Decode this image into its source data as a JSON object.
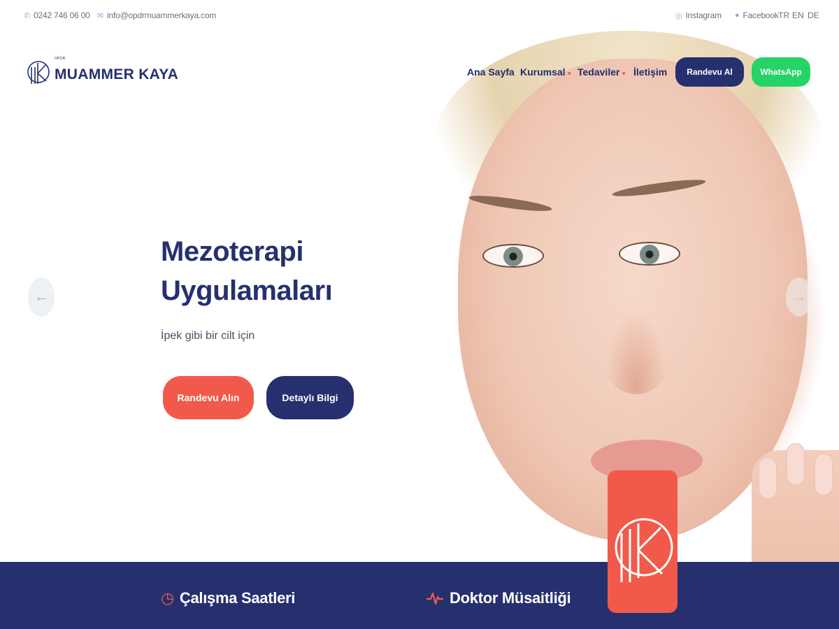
{
  "topbar": {
    "phone": "0242 746 06 00",
    "email": "info@opdrmuammerkaya.com",
    "instagram": "Instagram",
    "facebook": "Facebook",
    "languages": [
      "TR",
      "EN",
      "DE"
    ],
    "icons": {
      "phone": "phone-icon",
      "email": "mail-icon",
      "instagram": "instagram-icon",
      "facebook": "facebook-icon"
    }
  },
  "header": {
    "logo_small": "OP.DR.",
    "logo_text": "MUAMMER KAYA",
    "nav": [
      {
        "label": "Ana Sayfa",
        "has_dropdown": false
      },
      {
        "label": "Kurumsal",
        "has_dropdown": true
      },
      {
        "label": "Tedaviler",
        "has_dropdown": true
      },
      {
        "label": "İletişim",
        "has_dropdown": false
      }
    ],
    "appointment_button": "Randevu Al",
    "whatsapp_button": "WhatsApp"
  },
  "hero": {
    "title_line1": "Mezoterapi",
    "title_line2": "Uygulamaları",
    "subtitle": "İpek gibi bir cilt için",
    "primary_cta": "Randevu Alın",
    "secondary_cta": "Detaylı Bilgi",
    "prev_icon": "arrow-left-icon",
    "next_icon": "arrow-right-icon"
  },
  "info_band": {
    "working_hours_title": "Çalışma Saatleri",
    "doctor_availability_title": "Doktor Müsaitliği",
    "working_hours_icon": "clock-icon",
    "doctor_availability_icon": "heartbeat-icon"
  },
  "colors": {
    "navy": "#26306f",
    "coral": "#f15a4a",
    "whatsapp_green": "#25d366"
  }
}
